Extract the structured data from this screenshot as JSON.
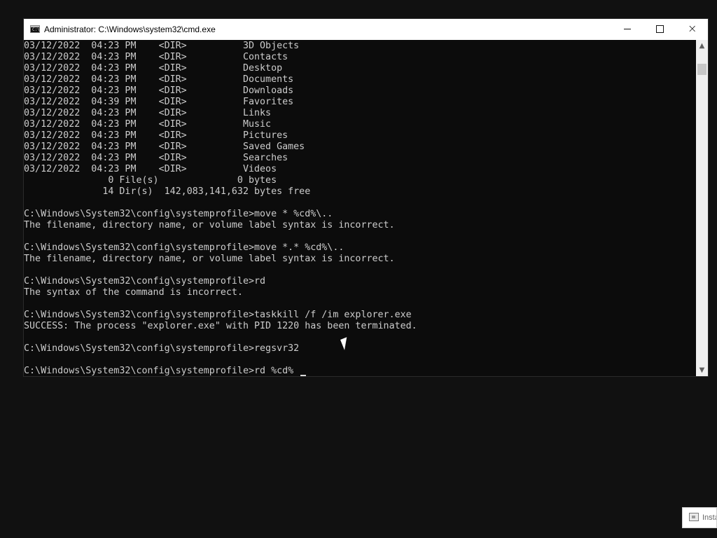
{
  "window": {
    "title": "Administrator: C:\\Windows\\system32\\cmd.exe",
    "minimize_icon": "minimize-icon",
    "maximize_icon": "maximize-icon",
    "close_label": "×"
  },
  "console": {
    "lines": [
      "03/12/2022  04:23 PM    <DIR>          3D Objects",
      "03/12/2022  04:23 PM    <DIR>          Contacts",
      "03/12/2022  04:23 PM    <DIR>          Desktop",
      "03/12/2022  04:23 PM    <DIR>          Documents",
      "03/12/2022  04:23 PM    <DIR>          Downloads",
      "03/12/2022  04:39 PM    <DIR>          Favorites",
      "03/12/2022  04:23 PM    <DIR>          Links",
      "03/12/2022  04:23 PM    <DIR>          Music",
      "03/12/2022  04:23 PM    <DIR>          Pictures",
      "03/12/2022  04:23 PM    <DIR>          Saved Games",
      "03/12/2022  04:23 PM    <DIR>          Searches",
      "03/12/2022  04:23 PM    <DIR>          Videos",
      "               0 File(s)              0 bytes",
      "              14 Dir(s)  142,083,141,632 bytes free",
      "",
      "C:\\Windows\\System32\\config\\systemprofile>move * %cd%\\..",
      "The filename, directory name, or volume label syntax is incorrect.",
      "",
      "C:\\Windows\\System32\\config\\systemprofile>move *.* %cd%\\..",
      "The filename, directory name, or volume label syntax is incorrect.",
      "",
      "C:\\Windows\\System32\\config\\systemprofile>rd",
      "The syntax of the command is incorrect.",
      "",
      "C:\\Windows\\System32\\config\\systemprofile>taskkill /f /im explorer.exe",
      "SUCCESS: The process \"explorer.exe\" with PID 1220 has been terminated.",
      "",
      "C:\\Windows\\System32\\config\\systemprofile>regsvr32",
      "",
      "C:\\Windows\\System32\\config\\systemprofile>rd %cd% "
    ]
  },
  "scrollbar": {
    "up_arrow": "▲",
    "down_arrow": "▼"
  },
  "taskbar": {
    "label": "Insta"
  },
  "colors": {
    "console_background": "#0c0c0c",
    "console_text": "#cccccc",
    "titlebar": "#ffffff",
    "desktop": "#111111"
  }
}
